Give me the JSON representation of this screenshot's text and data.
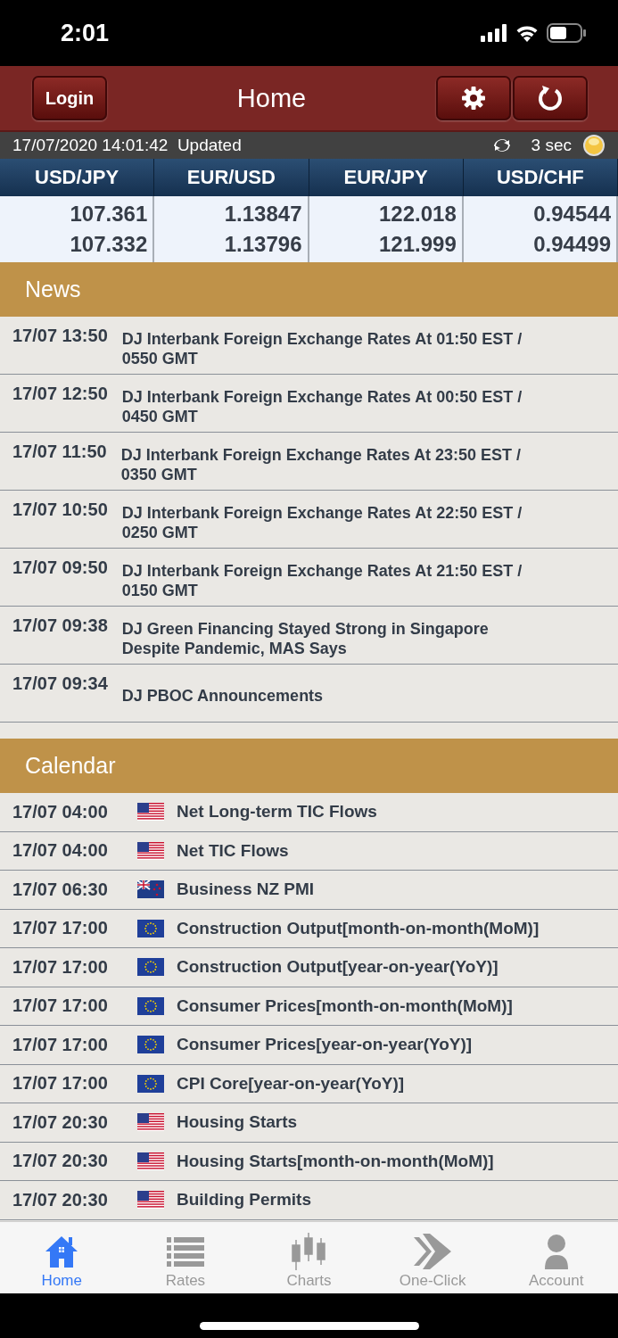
{
  "status_bar": {
    "time": "2:01"
  },
  "header": {
    "login": "Login",
    "title": "Home"
  },
  "info_bar": {
    "updated": "17/07/2020 14:01:42  Updated",
    "interval": "3 sec"
  },
  "rates": [
    {
      "pair": "USD/JPY",
      "bid": "107.361",
      "ask": "107.332"
    },
    {
      "pair": "EUR/USD",
      "bid": "1.13847",
      "ask": "1.13796"
    },
    {
      "pair": "EUR/JPY",
      "bid": "122.018",
      "ask": "121.999"
    },
    {
      "pair": "USD/CHF",
      "bid": "0.94544",
      "ask": "0.94499"
    }
  ],
  "news": {
    "title": "News",
    "items": [
      {
        "time": "17/07 13:50",
        "headline": "DJ Interbank Foreign Exchange Rates At 01:50 EST / 0550 GMT"
      },
      {
        "time": "17/07 12:50",
        "headline": "DJ Interbank Foreign Exchange Rates At 00:50 EST / 0450 GMT"
      },
      {
        "time": "17/07 11:50",
        "headline": "DJ Interbank Foreign Exchange Rates At 23:50 EST / 0350 GMT"
      },
      {
        "time": "17/07 10:50",
        "headline": "DJ Interbank Foreign Exchange Rates At 22:50 EST / 0250 GMT"
      },
      {
        "time": "17/07 09:50",
        "headline": "DJ Interbank Foreign Exchange Rates At 21:50 EST / 0150 GMT"
      },
      {
        "time": "17/07 09:38",
        "headline": "DJ Green Financing Stayed Strong in Singapore Despite Pandemic, MAS Says"
      },
      {
        "time": "17/07 09:34",
        "headline": "DJ PBOC Announcements"
      }
    ]
  },
  "calendar": {
    "title": "Calendar",
    "items": [
      {
        "time": "17/07 04:00",
        "kind": "us",
        "event": "Net Long-term TIC Flows"
      },
      {
        "time": "17/07 04:00",
        "kind": "us",
        "event": "Net TIC Flows"
      },
      {
        "time": "17/07 06:30",
        "kind": "nz",
        "event": "Business NZ PMI"
      },
      {
        "time": "17/07 17:00",
        "kind": "eu",
        "event": "Construction Output[month-on-month(MoM)]"
      },
      {
        "time": "17/07 17:00",
        "kind": "eu",
        "event": "Construction Output[year-on-year(YoY)]"
      },
      {
        "time": "17/07 17:00",
        "kind": "eu",
        "event": "Consumer Prices[month-on-month(MoM)]"
      },
      {
        "time": "17/07 17:00",
        "kind": "eu",
        "event": "Consumer Prices[year-on-year(YoY)]"
      },
      {
        "time": "17/07 17:00",
        "kind": "eu",
        "event": "CPI Core[year-on-year(YoY)]"
      },
      {
        "time": "17/07 20:30",
        "kind": "us",
        "event": "Housing Starts"
      },
      {
        "time": "17/07 20:30",
        "kind": "us",
        "event": "Housing Starts[month-on-month(MoM)]"
      },
      {
        "time": "17/07 20:30",
        "kind": "us",
        "event": "Building Permits"
      }
    ]
  },
  "tab_bar": [
    {
      "label": "Home",
      "kind": "home",
      "selected": true
    },
    {
      "label": "Rates",
      "kind": "list",
      "selected": false
    },
    {
      "label": "Charts",
      "kind": "candles",
      "selected": false
    },
    {
      "label": "One-Click",
      "kind": "arrow",
      "selected": false
    },
    {
      "label": "Account",
      "kind": "person",
      "selected": false
    }
  ]
}
